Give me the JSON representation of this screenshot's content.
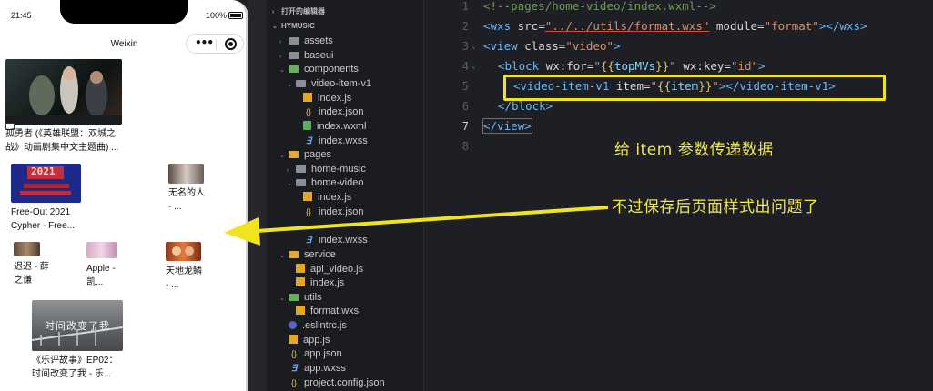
{
  "phone": {
    "time": "21:45",
    "battery": "100%",
    "nav_title": "Weixin",
    "videos": [
      {
        "title": "孤勇者 (《英雄联盟：双城之战》动画剧集中文主题曲) ..."
      },
      {
        "title": "Free-Out 2021 Cypher - Free..."
      },
      {
        "title": "无名的人 - ..."
      },
      {
        "title": "迟迟 - 薛之谦"
      },
      {
        "title": "Apple - 凯..."
      },
      {
        "title": "天地龙鳞 - ..."
      },
      {
        "title": "《乐评故事》EP02：时间改变了我 - 乐..."
      }
    ],
    "thumb_text": {
      "free_out": "2021",
      "story": "时间改变了我"
    }
  },
  "explorer": {
    "header_open": "打开的编辑器",
    "header_project": "HYMUSIC",
    "items": [
      {
        "label": "assets",
        "icon": "folder-icon"
      },
      {
        "label": "baseui",
        "icon": "folder-icon"
      },
      {
        "label": "components",
        "icon": "folder-icon"
      },
      {
        "label": "video-item-v1",
        "icon": "folder-icon"
      },
      {
        "label": "index.js",
        "icon": "js-file-icon"
      },
      {
        "label": "index.json",
        "icon": "json-file-icon"
      },
      {
        "label": "index.wxml",
        "icon": "wxml-file-icon"
      },
      {
        "label": "index.wxss",
        "icon": "wxss-file-icon"
      },
      {
        "label": "pages",
        "icon": "folder-icon"
      },
      {
        "label": "home-music",
        "icon": "folder-icon"
      },
      {
        "label": "home-video",
        "icon": "folder-icon"
      },
      {
        "label": "index.js",
        "icon": "js-file-icon"
      },
      {
        "label": "index.json",
        "icon": "json-file-icon"
      },
      {
        "label": "index.wxss",
        "icon": "wxss-file-icon"
      },
      {
        "label": "service",
        "icon": "folder-icon"
      },
      {
        "label": "api_video.js",
        "icon": "js-file-icon"
      },
      {
        "label": "index.js",
        "icon": "js-file-icon"
      },
      {
        "label": "utils",
        "icon": "folder-icon"
      },
      {
        "label": "format.wxs",
        "icon": "wxs-file-icon"
      },
      {
        "label": ".eslintrc.js",
        "icon": "eslint-icon"
      },
      {
        "label": "app.js",
        "icon": "js-file-icon"
      },
      {
        "label": "app.json",
        "icon": "json-file-icon"
      },
      {
        "label": "app.wxss",
        "icon": "wxss-file-icon"
      },
      {
        "label": "project.config.json",
        "icon": "json-file-icon"
      }
    ]
  },
  "editor": {
    "line_numbers": [
      "1",
      "2",
      "3",
      "4",
      "5",
      "6",
      "7",
      "8"
    ],
    "line1": "<!--pages/home-video/index.wxml-->",
    "line2": {
      "open": "<wxs",
      "attr1": " src=",
      "src": "\"../../utils/format.wxs\"",
      "attr2": " module=",
      "module": "\"format\"",
      "close": "></wxs>"
    },
    "line3": {
      "open": "<view",
      "attr": " class=",
      "val": "\"video\"",
      "close": ">"
    },
    "line4": {
      "open": "<block",
      "attr1": " wx:for=",
      "q1": "\"",
      "mus1": "{{",
      "var1": "topMVs",
      "mus2": "}}",
      "q2": "\"",
      "attr2": " wx:key=",
      "key": "\"id\"",
      "close": ">"
    },
    "line5": {
      "open": "<video-item-v1",
      "attr": " item=",
      "q1": "\"",
      "mus1": "{{",
      "var1": "item",
      "mus2": "}}",
      "q2": "\"",
      "close": "></video-item-v1>"
    },
    "line6": "</block>",
    "line7": "</view>"
  },
  "annotations": {
    "note1": "给 item 参数传递数据",
    "note2": "不过保存后页面样式出问题了",
    "highlight_color": "#f0e420"
  }
}
